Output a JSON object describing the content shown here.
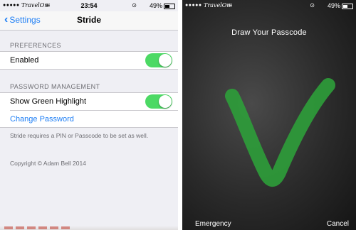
{
  "left": {
    "status": {
      "carrier": "TravelOn",
      "time": "23:54",
      "battery": "49%"
    },
    "nav": {
      "back_label": "Settings",
      "title": "Stride"
    },
    "preferences": {
      "header": "PREFERENCES",
      "enabled_label": "Enabled"
    },
    "password_management": {
      "header": "PASSWORD MANAGEMENT",
      "highlight_label": "Show Green Highlight",
      "change_password": "Change Password",
      "note": "Stride requires a PIN or Passcode to be set as well."
    },
    "copyright": "Copyright © Adam Bell 2014"
  },
  "right": {
    "status": {
      "carrier": "TravelOn",
      "battery": "49%"
    },
    "title": "Draw Your Passcode",
    "emergency": "Emergency",
    "cancel": "Cancel"
  },
  "colors": {
    "accent": "#1f7ff5",
    "toggle_on": "#4cd964",
    "stroke": "#2e9e3a"
  }
}
